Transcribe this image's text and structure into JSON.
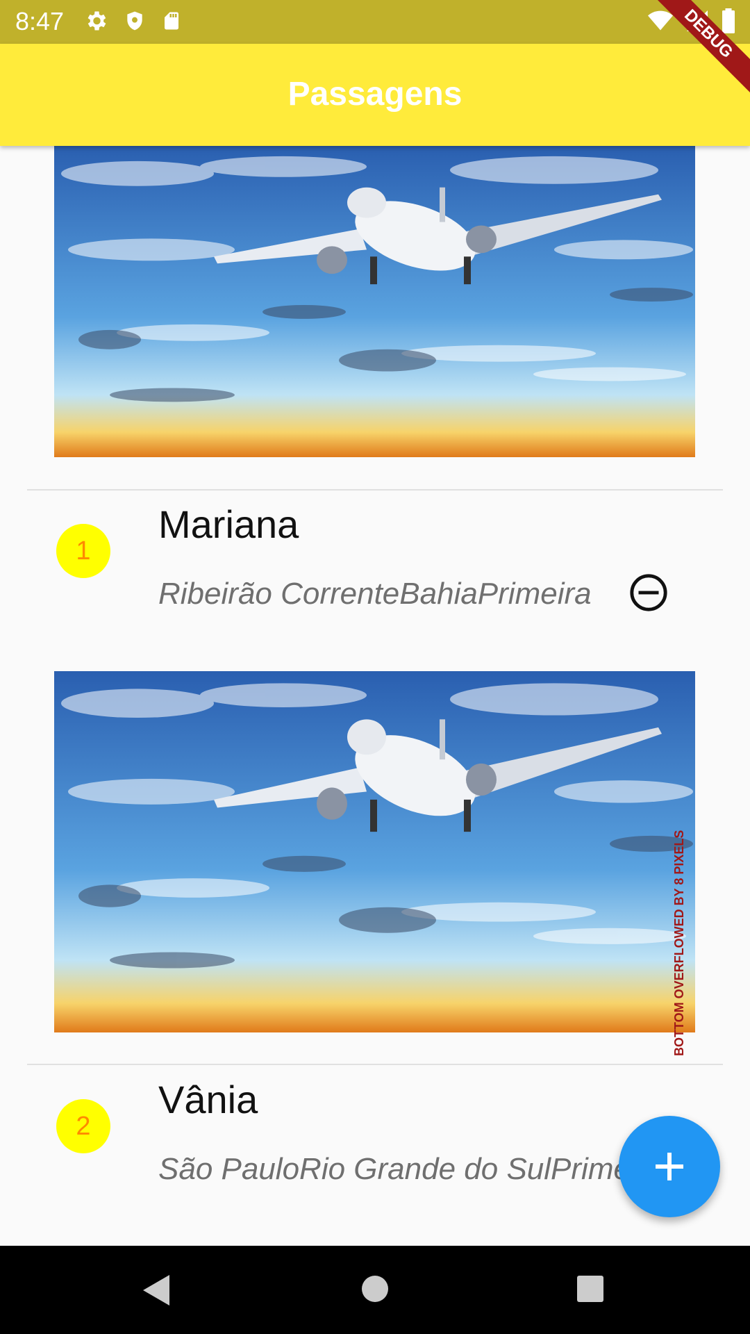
{
  "status_bar": {
    "time": "8:47",
    "icons": [
      "gear-icon",
      "shield-icon",
      "sd-card-icon",
      "wifi-icon",
      "signal-icon",
      "battery-icon"
    ]
  },
  "app_bar": {
    "title": "Passagens"
  },
  "debug_banner": "DEBUG",
  "tickets": [
    {
      "index": "1",
      "name": "Mariana",
      "subtitle": "Ribeirão CorrenteBahiaPrimeira"
    },
    {
      "index": "2",
      "name": "Vânia",
      "subtitle": "São PauloRio Grande do SulPrimeira"
    }
  ],
  "overflow_warning": "BOTTOM OVERFLOWED BY 8 PIXELS",
  "fab": {
    "icon": "plus-icon"
  },
  "nav_bar": {
    "icons": [
      "back-icon",
      "home-icon",
      "recents-icon"
    ]
  },
  "colors": {
    "app_bar": "#ffeb3b",
    "status_bar": "#c0b12b",
    "avatar": "#ffff00",
    "avatar_text": "#ff8a00",
    "fab": "#2196f3",
    "debug": "#a01818"
  }
}
